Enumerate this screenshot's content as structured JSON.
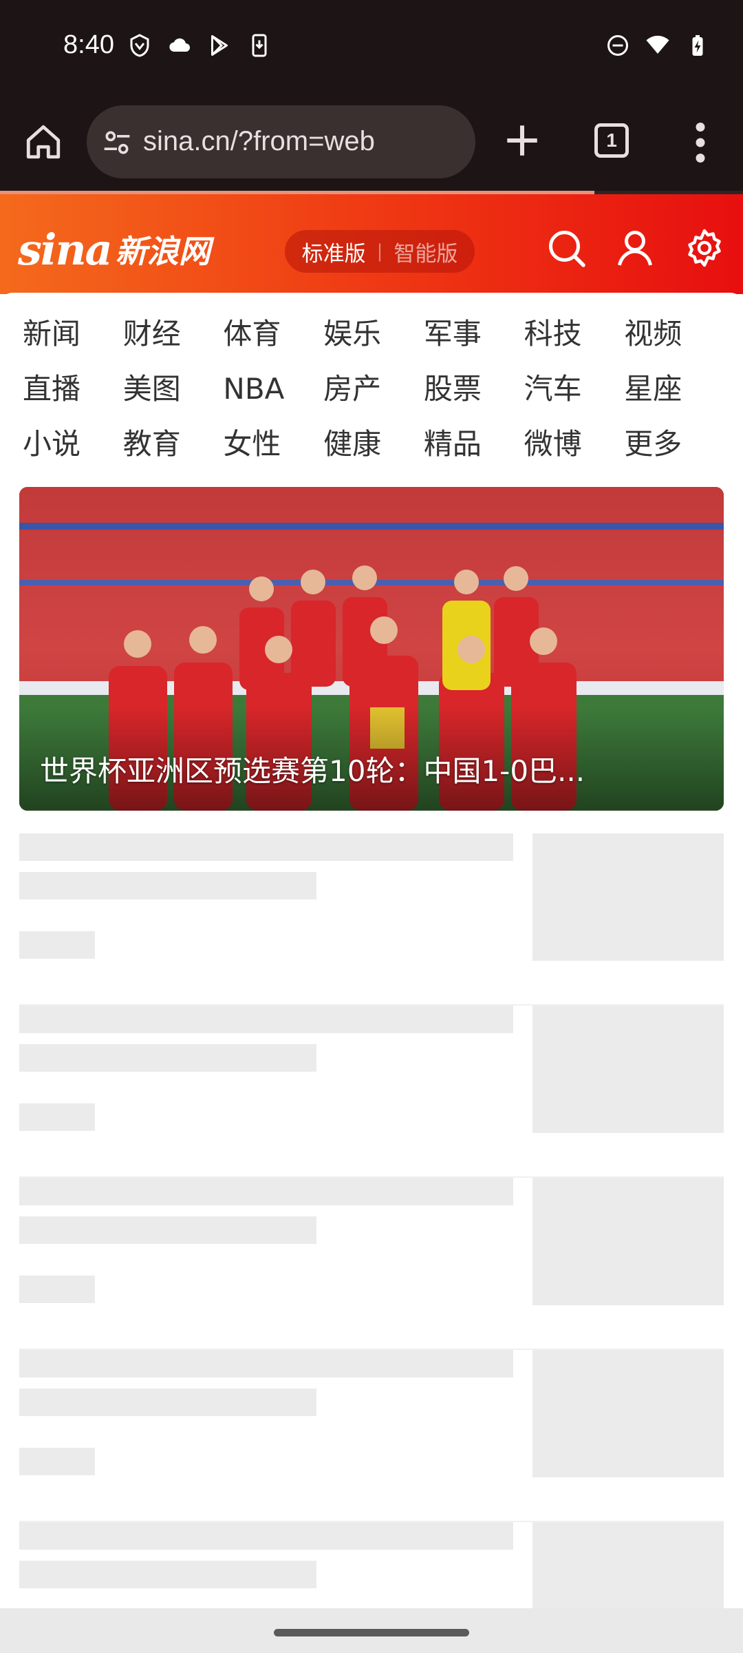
{
  "status_bar": {
    "time": "8:40",
    "left_icons": [
      "vpn-shield-icon",
      "cloud-icon",
      "play-store-icon",
      "download-icon"
    ],
    "right_icons": [
      "do-not-disturb-icon",
      "wifi-icon",
      "battery-charging-icon"
    ]
  },
  "browser": {
    "url": "sina.cn/?from=web",
    "tab_count": "1",
    "load_progress_percent": 80
  },
  "sina_header": {
    "logo_text": "sina",
    "logo_cn": "新浪网",
    "version_standard": "标准版",
    "version_divider": "|",
    "version_smart": "智能版",
    "brand_colors": [
      "#f46a1c",
      "#e70f0f"
    ]
  },
  "nav": {
    "items": [
      "新闻",
      "财经",
      "体育",
      "娱乐",
      "军事",
      "科技",
      "视频",
      "直播",
      "美图",
      "NBA",
      "房产",
      "股票",
      "汽车",
      "星座",
      "小说",
      "教育",
      "女性",
      "健康",
      "精品",
      "微博",
      "更多"
    ]
  },
  "hero": {
    "caption": "世界杯亚洲区预选赛第10轮：中国1-0巴..."
  },
  "skeleton_count": 5
}
